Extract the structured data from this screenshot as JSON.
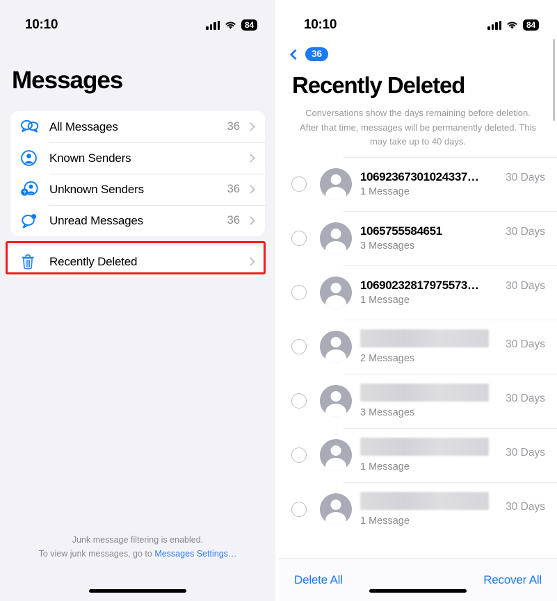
{
  "status_bar": {
    "time": "10:10",
    "battery": "84",
    "signal_icon": "cellular-bars-icon",
    "wifi_icon": "wifi-icon"
  },
  "left_pane": {
    "title": "Messages",
    "filters": [
      {
        "icon": "two-chat-bubbles-icon",
        "label": "All Messages",
        "count": "36"
      },
      {
        "icon": "person-circle-icon",
        "label": "Known Senders",
        "count": ""
      },
      {
        "icon": "person-question-icon",
        "label": "Unknown Senders",
        "count": "36"
      },
      {
        "icon": "chat-bubble-dot-icon",
        "label": "Unread Messages",
        "count": "36"
      }
    ],
    "recently_deleted": {
      "icon": "trash-icon",
      "label": "Recently Deleted",
      "highlight_color": "#f51b1b"
    },
    "footer": {
      "line1": "Junk message filtering is enabled.",
      "line2_prefix": "To view junk messages, go to ",
      "link": "Messages Settings…"
    }
  },
  "right_pane": {
    "back": {
      "icon": "chevron-left-icon",
      "badge": "36"
    },
    "title": "Recently Deleted",
    "description": "Conversations show the days remaining before deletion. After that time, messages will be permanently deleted. This may take up to 40 days.",
    "conversations": [
      {
        "name": "10692367301024337…",
        "redacted": false,
        "messages": "1 Message",
        "days": "30 Days"
      },
      {
        "name": "1065755584651",
        "redacted": false,
        "messages": "3 Messages",
        "days": "30 Days"
      },
      {
        "name": "10690232817975573…",
        "redacted": false,
        "messages": "1 Message",
        "days": "30 Days"
      },
      {
        "name": "",
        "redacted": true,
        "messages": "2 Messages",
        "days": "30 Days"
      },
      {
        "name": "",
        "redacted": true,
        "messages": "3 Messages",
        "days": "30 Days"
      },
      {
        "name": "",
        "redacted": true,
        "messages": "1 Message",
        "days": "30 Days"
      },
      {
        "name": "",
        "redacted": true,
        "messages": "1 Message",
        "days": "30 Days"
      }
    ],
    "toolbar": {
      "delete_all": "Delete All",
      "recover_all": "Recover All"
    }
  },
  "colors": {
    "accent_blue": "#1b7af5",
    "highlight_red": "#f51b1b",
    "secondary_text": "#8a8a8e",
    "page_bg": "#f2f2f7"
  }
}
